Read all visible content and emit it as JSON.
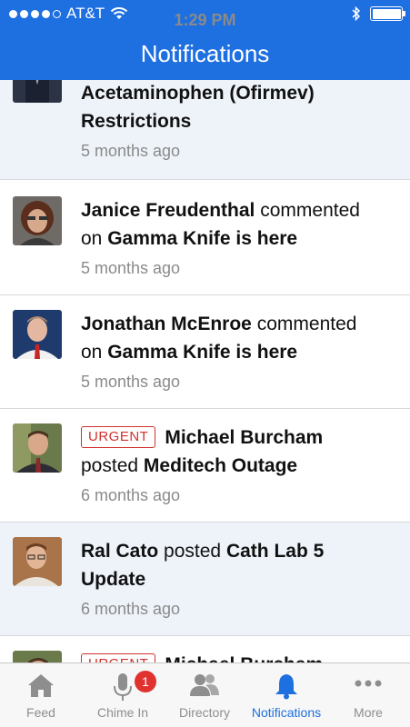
{
  "status_bar": {
    "carrier": "AT&T",
    "time": "1:29 PM"
  },
  "header": {
    "title": "Notifications"
  },
  "notifications": [
    {
      "line1": "Acetaminophen (Ofirmev)",
      "line2": "Restrictions",
      "time": "5 months ago"
    },
    {
      "actor": "Janice Freudenthal",
      "verb": "commented",
      "prep": "on",
      "subject": "Gamma Knife is here",
      "time": "5 months ago"
    },
    {
      "actor": "Jonathan McEnroe",
      "verb": "commented",
      "prep": "on",
      "subject": "Gamma Knife is here",
      "time": "5 months ago"
    },
    {
      "badge": "URGENT",
      "actor": "Michael Burcham",
      "verb": "posted",
      "subject": "Meditech Outage",
      "time": "6 months ago"
    },
    {
      "actor": "Ral Cato",
      "verb": "posted",
      "subject": "Cath Lab 5",
      "subject2": "Update",
      "time": "6 months ago"
    },
    {
      "badge": "URGENT",
      "actor": "Michael Burcham"
    }
  ],
  "tabs": [
    {
      "label": "Feed",
      "icon": "house-icon"
    },
    {
      "label": "Chime In",
      "icon": "microphone-icon",
      "badge": "1"
    },
    {
      "label": "Directory",
      "icon": "people-icon"
    },
    {
      "label": "Notifications",
      "icon": "bell-icon",
      "active": true
    },
    {
      "label": "More",
      "icon": "ellipsis-icon"
    }
  ],
  "colors": {
    "brand": "#1e6fe0",
    "urgent": "#d0312d",
    "badge": "#e0322f",
    "alt_row": "#eef3fa"
  }
}
